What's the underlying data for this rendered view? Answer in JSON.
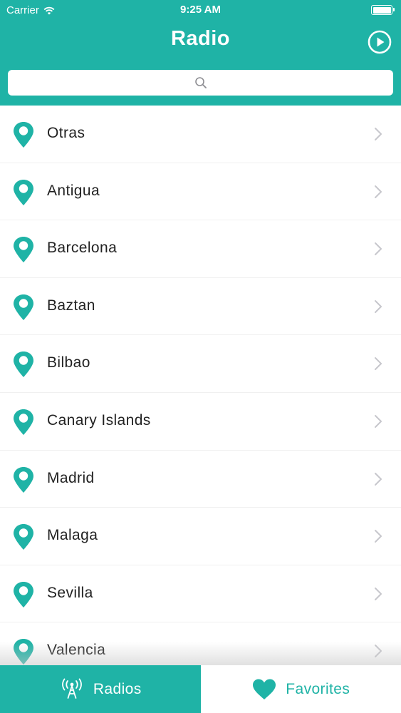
{
  "status_bar": {
    "carrier": "Carrier",
    "time": "9:25 AM"
  },
  "header": {
    "title": "Radio",
    "play_icon": "play-circle-icon"
  },
  "search": {
    "placeholder": "",
    "icon": "search-icon"
  },
  "regions": [
    {
      "label": "Otras"
    },
    {
      "label": "Antigua"
    },
    {
      "label": "Barcelona"
    },
    {
      "label": "Baztan"
    },
    {
      "label": "Bilbao"
    },
    {
      "label": "Canary Islands"
    },
    {
      "label": "Madrid"
    },
    {
      "label": "Malaga"
    },
    {
      "label": "Sevilla"
    },
    {
      "label": "Valencia"
    }
  ],
  "tabs": {
    "radios": {
      "label": "Radios",
      "icon": "radio-tower-icon",
      "selected": true
    },
    "favorites": {
      "label": "Favorites",
      "icon": "heart-icon",
      "selected": false
    }
  },
  "colors": {
    "accent": "#1fb3a6",
    "text": "#222222",
    "chevron": "#c7c7cc"
  }
}
